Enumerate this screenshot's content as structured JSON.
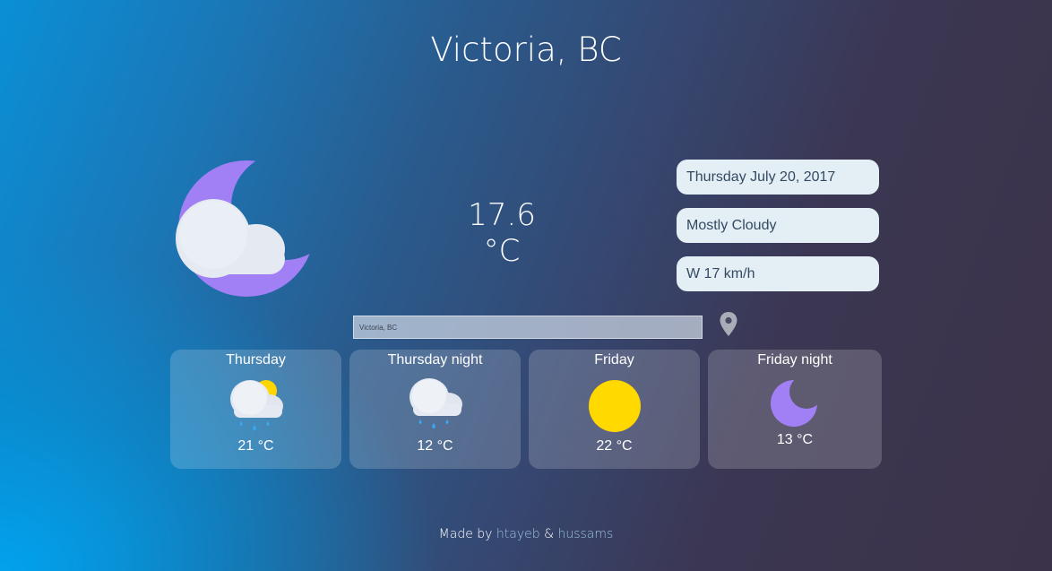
{
  "title": "Victoria, BC",
  "current": {
    "icon": "moon-cloud-icon",
    "temperature": "17.6 °C",
    "date": "Thursday July 20, 2017",
    "condition": "Mostly Cloudy",
    "wind": "W 17 km/h"
  },
  "search": {
    "value": "Victoria, BC",
    "location_icon": "location-pin-icon"
  },
  "forecast": [
    {
      "label": "Thursday",
      "icon": "sun-cloud-rain-icon",
      "temp": "21 °C"
    },
    {
      "label": "Thursday night",
      "icon": "cloud-rain-icon",
      "temp": "12 °C"
    },
    {
      "label": "Friday",
      "icon": "sun-icon",
      "temp": "22 °C"
    },
    {
      "label": "Friday night",
      "icon": "moon-icon",
      "temp": "13 °C"
    }
  ],
  "footer": {
    "prefix": "Made by",
    "author1": "htayeb",
    "separator": "&",
    "author2": "hussams"
  },
  "colors": {
    "moon": "#a17ff5",
    "sun": "#ffd600",
    "rain": "#3aa8f0",
    "cloud": "#e6ebf2",
    "pill_bg": "#e3eef5",
    "pill_text": "#344a63"
  }
}
